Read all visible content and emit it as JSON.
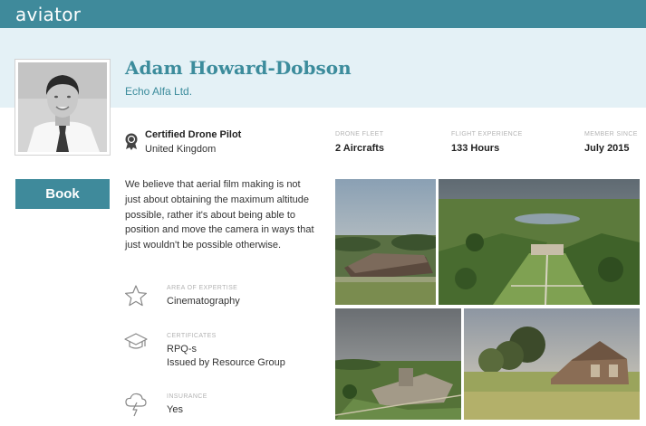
{
  "brand": {
    "logo_text": "aviator"
  },
  "profile": {
    "name": "Adam Howard-Dobson",
    "company": "Echo Alfa Ltd.",
    "certification": "Certified Drone Pilot",
    "location": "United Kingdom"
  },
  "stats": [
    {
      "label": "DRONE FLEET",
      "value": "2 Aircrafts"
    },
    {
      "label": "FLIGHT EXPERIENCE",
      "value": "133 Hours"
    },
    {
      "label": "MEMBER SINCE",
      "value": "July 2015"
    }
  ],
  "actions": {
    "book_label": "Book"
  },
  "bio": {
    "lines": [
      "We believe that aerial film making is not",
      "just about obtaining the maximum altitude",
      "possible, rather it's about being able to",
      "position and move the camera in ways that",
      "just wouldn't be possible otherwise."
    ]
  },
  "details": [
    {
      "label": "AREA OF EXPERTISE",
      "values": [
        "Cinematography"
      ],
      "icon": "star-icon"
    },
    {
      "label": "CERTIFICATES",
      "values": [
        "RPQ-s",
        "Issued by Resource Group"
      ],
      "icon": "graduation-cap-icon"
    },
    {
      "label": "INSURANCE",
      "values": [
        "Yes"
      ],
      "icon": "storm-cloud-icon"
    }
  ],
  "colors": {
    "brand": "#3f8a9b",
    "hero_bg": "#e4f1f6",
    "accent_text": "#3c8c9c"
  }
}
